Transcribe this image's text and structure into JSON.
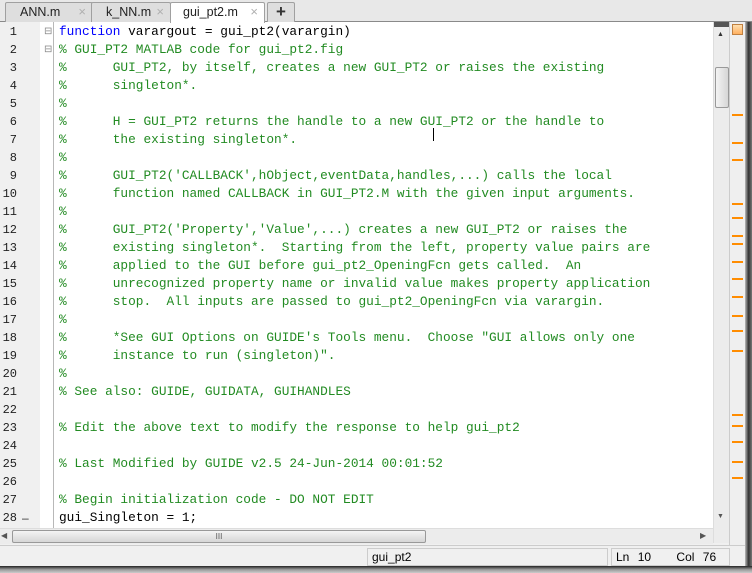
{
  "tabs": [
    {
      "label": "ANN.m",
      "active": false
    },
    {
      "label": "k_NN.m",
      "active": false
    },
    {
      "label": "gui_pt2.m",
      "active": true
    }
  ],
  "new_tab_label": "+",
  "close_glyph": "×",
  "colors": {
    "keyword": "#0000ff",
    "comment": "#228b22",
    "marker": "#ff8c00"
  },
  "code_lines": [
    "function varargout = gui_pt2(varargin)",
    "% GUI_PT2 MATLAB code for gui_pt2.fig",
    "%      GUI_PT2, by itself, creates a new GUI_PT2 or raises the existing",
    "%      singleton*.",
    "%",
    "%      H = GUI_PT2 returns the handle to a new GUI_PT2 or the handle to",
    "%      the existing singleton*.",
    "%",
    "%      GUI_PT2('CALLBACK',hObject,eventData,handles,...) calls the local",
    "%      function named CALLBACK in GUI_PT2.M with the given input arguments.",
    "%",
    "%      GUI_PT2('Property','Value',...) creates a new GUI_PT2 or raises the",
    "%      existing singleton*.  Starting from the left, property value pairs are",
    "%      applied to the GUI before gui_pt2_OpeningFcn gets called.  An",
    "%      unrecognized property name or invalid value makes property application",
    "%      stop.  All inputs are passed to gui_pt2_OpeningFcn via varargin.",
    "%",
    "%      *See GUI Options on GUIDE's Tools menu.  Choose \"GUI allows only one",
    "%      instance to run (singleton)\".",
    "%",
    "% See also: GUIDE, GUIDATA, GUIHANDLES",
    "",
    "% Edit the above text to modify the response to help gui_pt2",
    "",
    "% Last Modified by GUIDE v2.5 24-Jun-2014 00:01:52",
    "",
    "% Begin initialization code - DO NOT EDIT",
    "gui_Singleton = 1;"
  ],
  "hscroll_grip": "III",
  "status": {
    "function_name": "gui_pt2",
    "ln_label": "Ln",
    "ln_value": "10",
    "col_label": "Col",
    "col_value": "76"
  }
}
